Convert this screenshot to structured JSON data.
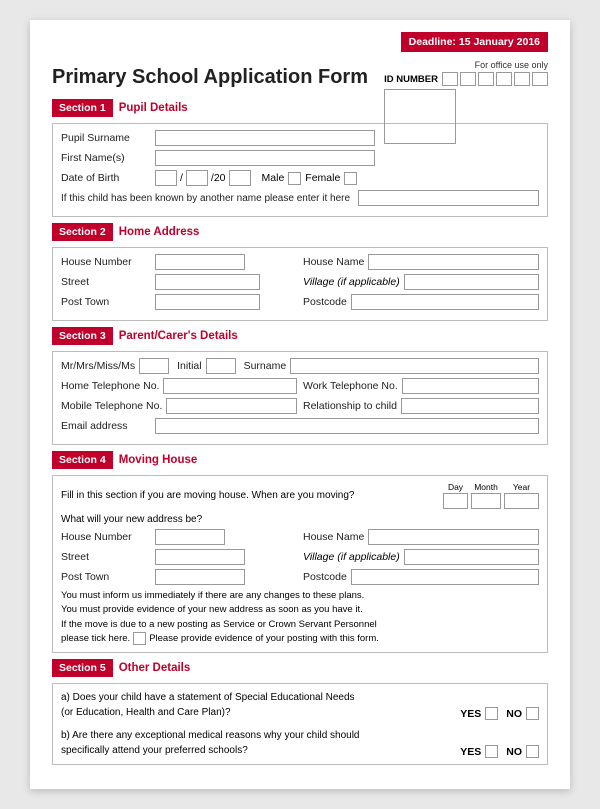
{
  "deadline": "Deadline: 15 January 2016",
  "office_use": "For office use only",
  "id_number_label": "ID NUMBER",
  "form_title": "Primary School Application Form",
  "sections": [
    {
      "id": "Section 1",
      "title": "Pupil Details",
      "fields": [
        {
          "label": "Pupil Surname"
        },
        {
          "label": "First Name(s)"
        },
        {
          "label": "Date of Birth"
        },
        {
          "label": "If this child has been known by another name please enter it here"
        }
      ]
    },
    {
      "id": "Section 2",
      "title": "Home Address",
      "rows": [
        [
          {
            "label": "House Number"
          },
          {
            "label": "House Name"
          }
        ],
        [
          {
            "label": "Street"
          },
          {
            "label": "Village (if applicable)"
          }
        ],
        [
          {
            "label": "Post Town"
          },
          {
            "label": "Postcode"
          }
        ]
      ]
    },
    {
      "id": "Section 3",
      "title": "Parent/Carer's Details",
      "rows": [
        [
          {
            "label": "Mr/Mrs/Miss/Ms"
          },
          {
            "label": "Initial"
          },
          {
            "label": "Surname"
          }
        ],
        [
          {
            "label": "Home Telephone No."
          },
          {
            "label": "Work Telephone No."
          }
        ],
        [
          {
            "label": "Mobile Telephone No."
          },
          {
            "label": "Relationship to child"
          }
        ],
        [
          {
            "label": "Email address"
          }
        ]
      ]
    },
    {
      "id": "Section 4",
      "title": "Moving House",
      "moving_text": "Fill in this section if you are moving house. When are you moving?",
      "new_address": "What will your new address be?",
      "dmy_labels": [
        "Day",
        "Month",
        "Year"
      ],
      "notice_lines": [
        "You must inform us immediately if there are any changes to these plans.",
        "You must provide evidence of your new address as soon as you have it.",
        "If the move is due to a new posting as Service or Crown Servant Personnel",
        "please tick here.   Please provide evidence of your posting with this form."
      ]
    },
    {
      "id": "Section 5",
      "title": "Other Details",
      "questions": [
        {
          "text": "a) Does your child have a statement of Special Educational Needs\n(or Education, Health and Care Plan)?",
          "yes_label": "YES",
          "no_label": "NO"
        },
        {
          "text": "b) Are there any exceptional medical reasons why your child should\nspecifically attend your preferred schools?",
          "yes_label": "YES",
          "no_label": "NO"
        }
      ]
    }
  ]
}
